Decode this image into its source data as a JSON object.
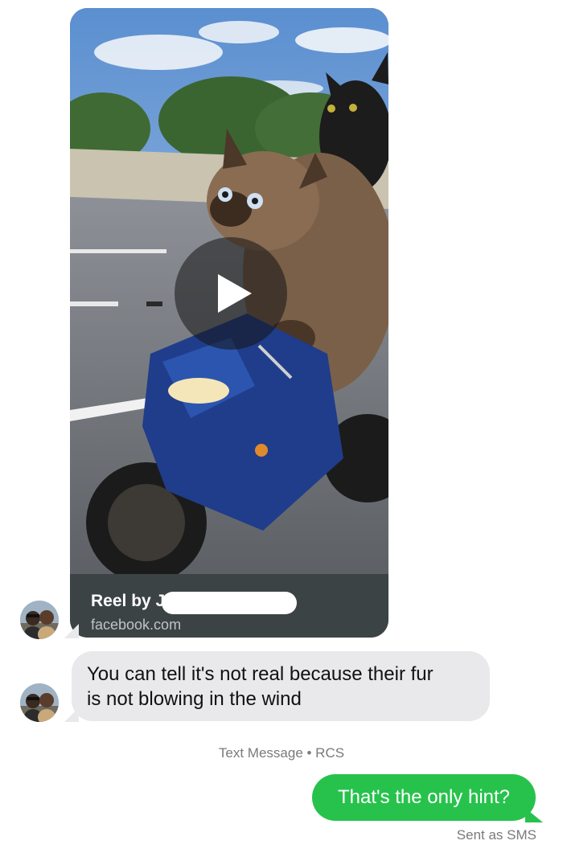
{
  "conversation": {
    "reel": {
      "title": "Reel by J",
      "source": "facebook.com",
      "media_description_icon": "play-icon"
    },
    "incoming_message": {
      "line1": "You can tell it's not real because their fur",
      "line2": "is not blowing in the wind"
    },
    "channel_label": "Text Message • RCS",
    "outgoing_message": {
      "text": "That's the only hint?",
      "status": "Sent as SMS"
    }
  },
  "colors": {
    "incoming_bubble": "#e9e9eb",
    "outgoing_bubble": "#27c24c",
    "reel_footer": "#3c4345",
    "meta_text": "#7a7a7a"
  }
}
